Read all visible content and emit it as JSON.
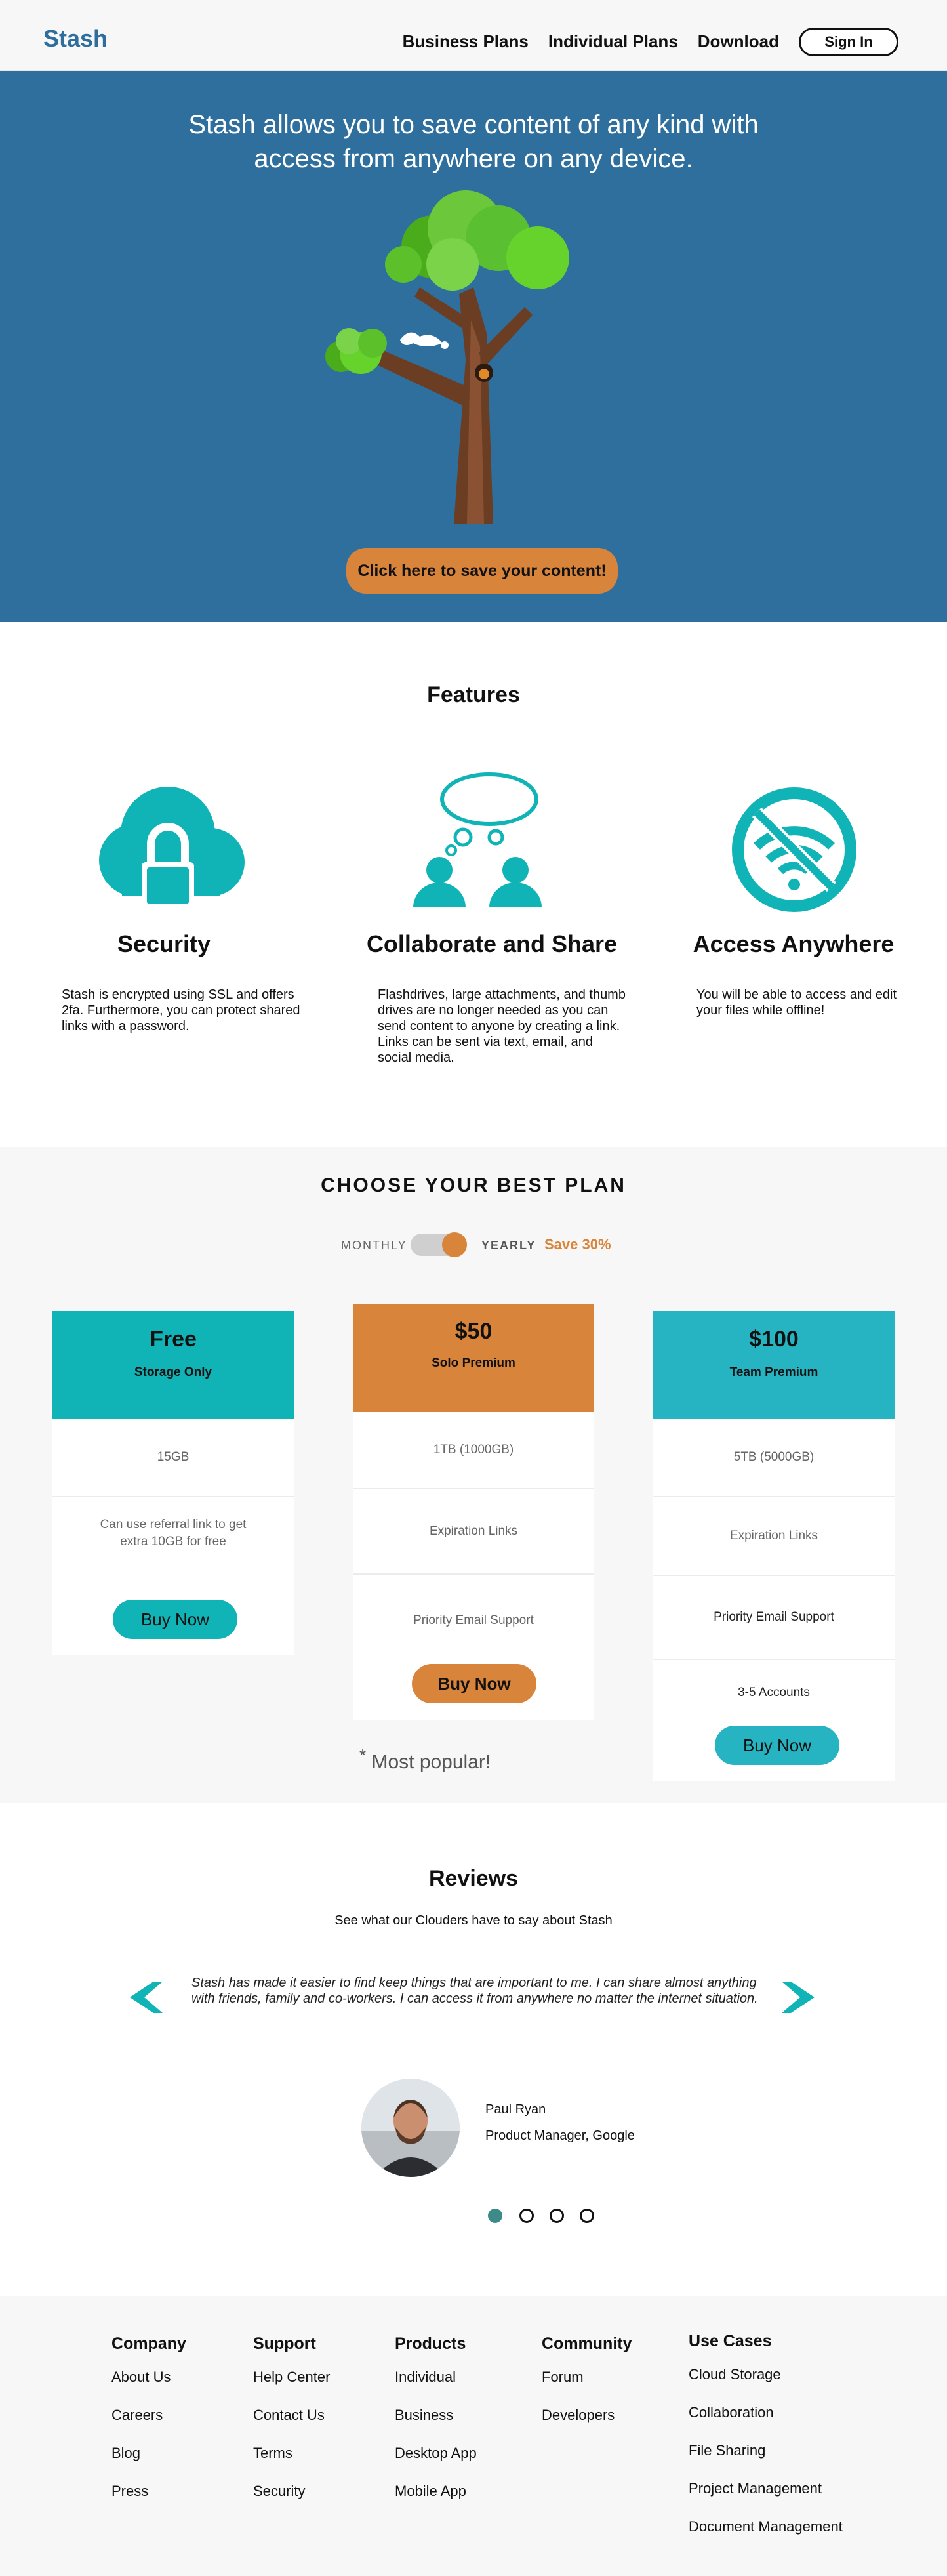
{
  "nav": {
    "logo": "Stash",
    "links": [
      "Business Plans",
      "Individual Plans",
      "Download"
    ],
    "signin": "Sign In"
  },
  "hero": {
    "title_line1": "Stash allows you to save content of any kind with",
    "title_line2": "access from anywhere on any device.",
    "cta": "Click here to save your content!"
  },
  "features": {
    "title": "Features",
    "items": [
      {
        "icon": "cloud-lock-icon",
        "title": "Security",
        "desc": "Stash is encrypted using SSL and offers 2fa. Furthermore, you can protect shared links with a password."
      },
      {
        "icon": "collaborate-icon",
        "title": "Collaborate and Share",
        "desc": "Flashdrives, large attachments, and thumb  drives  are no longer needed as you can  send content to anyone by creating a link.  Links can be sent via text, email, and social media."
      },
      {
        "icon": "no-wifi-icon",
        "title": "Access Anywhere",
        "desc": "You will be  able to access and edit your files while offline!"
      }
    ]
  },
  "pricing": {
    "heading": "CHOOSE YOUR BEST PLAN",
    "monthly": "MONTHLY",
    "yearly": "YEARLY",
    "save": "Save 30%",
    "popular_mark": "*",
    "popular": "Most popular!",
    "colors": {
      "free": "#10b3b6",
      "premium": "#d9843b",
      "team": "#27b4c2"
    },
    "plans": [
      {
        "price": "Free",
        "name": "Storage Only",
        "rows": [
          "15GB",
          "Can use referral link to get extra 10GB for free"
        ],
        "buy": "Buy Now"
      },
      {
        "price": "$50",
        "name": "Solo Premium",
        "rows": [
          "1TB (1000GB)",
          "Expiration Links",
          "Priority Email Support"
        ],
        "buy": "Buy Now"
      },
      {
        "price": "$100",
        "name": "Team Premium",
        "rows": [
          "5TB (5000GB)",
          "Expiration Links",
          "Priority Email Support",
          "3-5 Accounts"
        ],
        "buy": "Buy Now"
      }
    ]
  },
  "reviews": {
    "title": "Reviews",
    "subtitle": "See what our Clouders have to say about Stash",
    "quote": "Stash has made it easier to find keep things that are important to me. I can share almost anything with friends, family and co-workers. I can access it from anywhere no matter the internet situation.",
    "name": "Paul Ryan",
    "role": "Product Manager, Google",
    "active_dot": 1,
    "dot_count": 4
  },
  "footer": {
    "columns": [
      {
        "head": "Company",
        "links": [
          "About Us",
          "Careers",
          "Blog",
          "Press"
        ]
      },
      {
        "head": "Support",
        "links": [
          "Help Center",
          "Contact Us",
          "Terms",
          "Security"
        ]
      },
      {
        "head": "Products",
        "links": [
          "Individual",
          "Business",
          "Desktop App",
          "Mobile App"
        ]
      },
      {
        "head": "Community",
        "links": [
          "Forum",
          "Developers"
        ]
      },
      {
        "head": "Use Cases",
        "links": [
          "Cloud Storage",
          "Collaboration",
          "File Sharing",
          "Project Management",
          "Document Management"
        ]
      }
    ]
  }
}
